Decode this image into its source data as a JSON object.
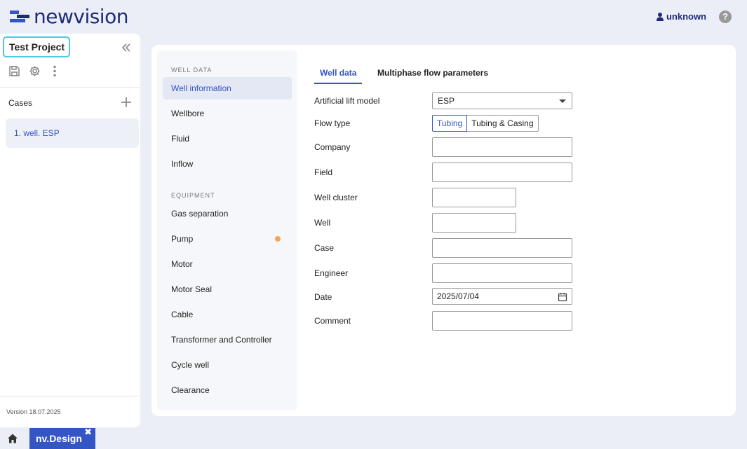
{
  "app": {
    "brand": "newvision",
    "brand_color": "#1d2a78",
    "accent_color": "#3455c4"
  },
  "header": {
    "user_name": "unknown",
    "help_label": "?"
  },
  "sidebar": {
    "project_title": "Test Project",
    "cases_label": "Cases",
    "cases": [
      {
        "label": "1. well. ESP"
      }
    ],
    "version": "Version 18.07.2025"
  },
  "nav": {
    "sections": [
      {
        "title": "WELL DATA",
        "items": [
          "Well information",
          "Wellbore",
          "Fluid",
          "Inflow"
        ]
      },
      {
        "title": "EQUIPMENT",
        "items": [
          "Gas separation",
          "Pump",
          "Motor",
          "Motor Seal",
          "Cable",
          "Transformer and Controller",
          "Cycle well",
          "Clearance"
        ]
      }
    ],
    "active_item": "Well information",
    "indicator_item": "Pump"
  },
  "tabs": [
    {
      "label": "Well data",
      "active": true
    },
    {
      "label": "Multiphase flow parameters",
      "active": false
    }
  ],
  "form": {
    "artificial_lift_label": "Artificial lift model",
    "artificial_lift_value": "ESP",
    "flow_type_label": "Flow type",
    "flow_type_options": [
      "Tubing",
      "Tubing & Casing"
    ],
    "flow_type_selected": "Tubing",
    "company_label": "Company",
    "company_value": "",
    "field_label": "Field",
    "field_value": "",
    "well_cluster_label": "Well cluster",
    "well_cluster_value": "",
    "well_label": "Well",
    "well_value": "",
    "case_label": "Case",
    "case_value": "",
    "engineer_label": "Engineer",
    "engineer_value": "",
    "date_label": "Date",
    "date_value": "2025/07/04",
    "comment_label": "Comment",
    "comment_value": ""
  },
  "taskbar": {
    "app_tab_label": "nv.Design",
    "close_glyph": "✖"
  }
}
